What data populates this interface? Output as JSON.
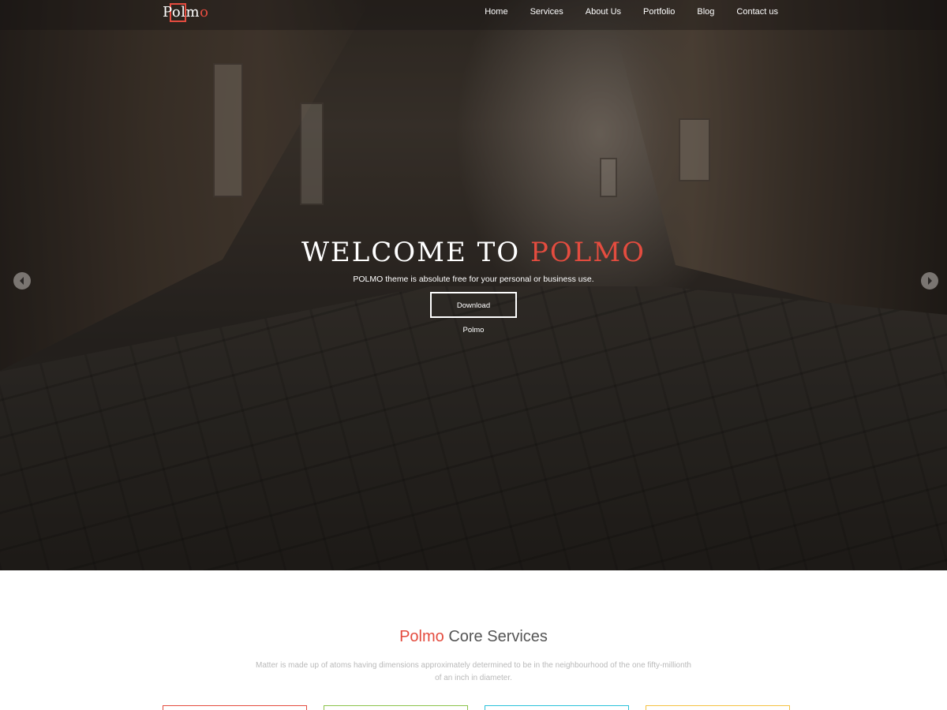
{
  "header": {
    "logo": {
      "part1": "Pol",
      "part2": "m",
      "part3": "o"
    },
    "nav": [
      {
        "label": "Home"
      },
      {
        "label": "Services"
      },
      {
        "label": "About Us"
      },
      {
        "label": "Portfolio"
      },
      {
        "label": "Blog"
      },
      {
        "label": "Contact us"
      }
    ]
  },
  "hero": {
    "title_main": "WELCOME TO ",
    "title_accent": "POLMO",
    "subtitle": "POLMO theme is absolute free for your personal or business use.",
    "button_label": "Download Polmo",
    "prev_icon": "chevron-left-icon",
    "next_icon": "chevron-right-icon"
  },
  "services": {
    "title_accent": "Polmo",
    "title_rest": " Core Services",
    "description": "Matter is made up of atoms having dimensions approximately determined to be in the neighbourhood of the one fifty-millionth of an inch in diameter.",
    "card_colors": [
      "#e44c3f",
      "#8bc34a",
      "#29c1d9",
      "#f5c242"
    ]
  },
  "colors": {
    "accent": "#e44c3f"
  }
}
